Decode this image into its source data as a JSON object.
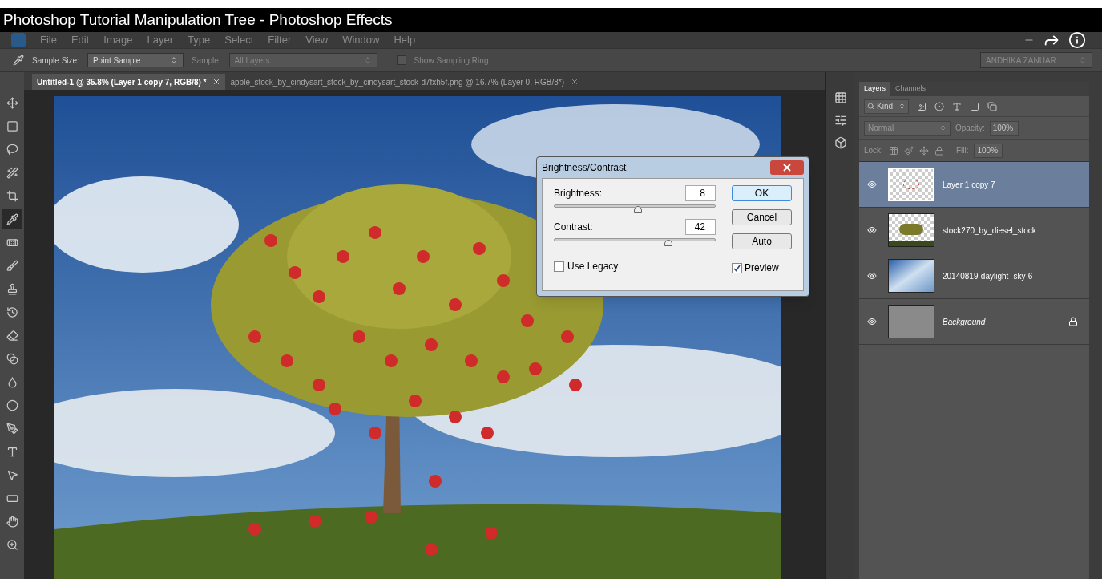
{
  "video_title": "Photoshop Tutorial Manipulation Tree - Photoshop Effects",
  "menu": [
    "File",
    "Edit",
    "Image",
    "Layer",
    "Type",
    "Select",
    "Filter",
    "View",
    "Window",
    "Help"
  ],
  "options_bar": {
    "sample_size_label": "Sample Size:",
    "sample_size": "Point Sample",
    "sample_label": "Sample:",
    "sample": "All Layers",
    "sampling_ring": {
      "label": "Show Sampling Ring",
      "checked": false
    },
    "workspace": "ANDHIKA ZANUAR"
  },
  "doc_tabs": [
    {
      "label": "Untitled-1 @ 35.8% (Layer 1 copy 7, RGB/8) *",
      "selected": true
    },
    {
      "label": "apple_stock_by_cindysart_stock_by_cindysart_stock-d7fxh5f.png @ 16.7% (Layer 0, RGB/8*)",
      "selected": false
    }
  ],
  "tools": [
    {
      "kind": "move",
      "selected": false
    },
    {
      "kind": "marquee",
      "selected": false
    },
    {
      "kind": "lasso",
      "selected": false
    },
    {
      "kind": "wand",
      "selected": false
    },
    {
      "kind": "crop",
      "selected": false
    },
    {
      "kind": "eyedropper",
      "selected": true
    },
    {
      "kind": "healing",
      "selected": false
    },
    {
      "kind": "brush",
      "selected": false
    },
    {
      "kind": "stamp",
      "selected": false
    },
    {
      "kind": "history",
      "selected": false
    },
    {
      "kind": "eraser",
      "selected": false
    },
    {
      "kind": "gradient",
      "selected": false
    },
    {
      "kind": "blur",
      "selected": false
    },
    {
      "kind": "dodge",
      "selected": false
    },
    {
      "kind": "pen",
      "selected": false
    },
    {
      "kind": "type",
      "selected": false
    },
    {
      "kind": "select",
      "selected": false
    },
    {
      "kind": "shape",
      "selected": false
    },
    {
      "kind": "hand",
      "selected": false
    },
    {
      "kind": "zoom",
      "selected": false
    }
  ],
  "dialog": {
    "title": "Brightness/Contrast",
    "sliders": [
      {
        "label": "Brightness:",
        "value": "8",
        "level": 0.52
      },
      {
        "label": "Contrast:",
        "value": "42",
        "level": 0.71
      }
    ],
    "buttons": [
      {
        "label": "OK",
        "selected": true
      },
      {
        "label": "Cancel",
        "selected": false
      },
      {
        "label": "Auto",
        "selected": false
      }
    ],
    "use_legacy": {
      "label": "Use Legacy",
      "checked": false
    },
    "preview": {
      "label": "Preview",
      "checked": true
    }
  },
  "layers_panel": {
    "tabs": [
      {
        "label": "Layers",
        "selected": true
      },
      {
        "label": "Channels",
        "selected": false
      }
    ],
    "filter": "Kind",
    "blend_mode": "Normal",
    "opacity_label": "Opacity:",
    "opacity": "100%",
    "lock_label": "Lock:",
    "fill_label": "Fill:",
    "fill": "100%",
    "layers": [
      {
        "name": "Layer 1 copy 7",
        "kind": "apples",
        "selected": true,
        "visible": true,
        "locked": false
      },
      {
        "name": "stock270_by_diesel_stock",
        "kind": "tree",
        "selected": false,
        "visible": true,
        "locked": false
      },
      {
        "name": "20140819-daylight -sky-6",
        "kind": "sky",
        "selected": false,
        "visible": true,
        "locked": false
      },
      {
        "name": "Background",
        "kind": "background",
        "selected": false,
        "visible": true,
        "locked": true
      }
    ]
  }
}
